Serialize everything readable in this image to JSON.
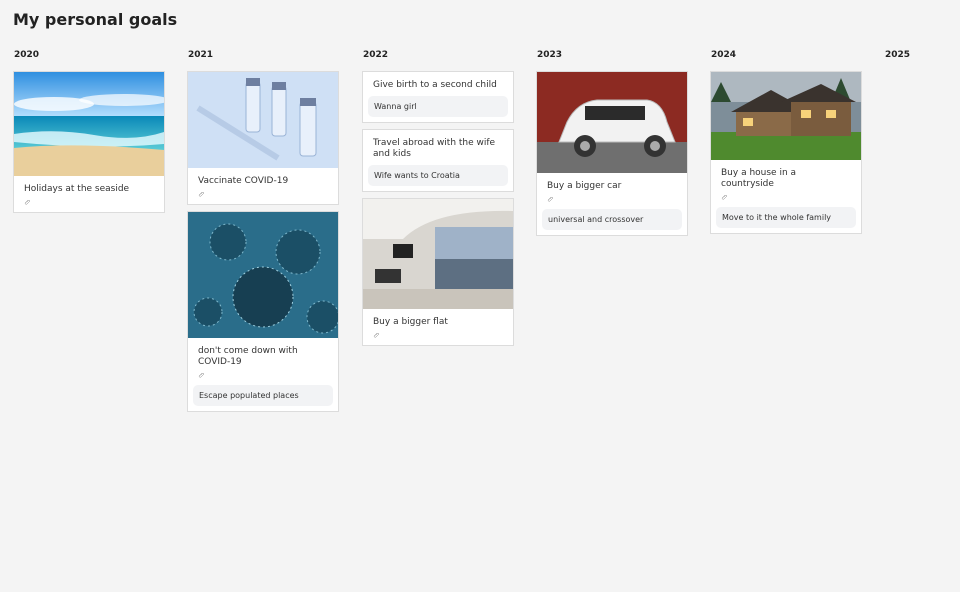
{
  "page": {
    "title": "My personal goals"
  },
  "columns": [
    {
      "year": "2020",
      "cards": [
        {
          "title": "Holidays at the seaside",
          "image": "seaside-photo",
          "attachment": true,
          "note": ""
        }
      ]
    },
    {
      "year": "2021",
      "cards": [
        {
          "title": "Vaccinate COVID-19",
          "image": "vaccine-photo",
          "attachment": true,
          "note": ""
        },
        {
          "title": "don't come down with COVID-19",
          "image": "virus-photo",
          "attachment": true,
          "note": "Escape populated places"
        }
      ]
    },
    {
      "year": "2022",
      "cards": [
        {
          "title": "Give birth to a second child",
          "note": "Wanna girl"
        },
        {
          "title": "Travel abroad with the wife and kids",
          "note": "Wife wants to Croatia"
        },
        {
          "title": "Buy a bigger flat",
          "image": "flat-photo",
          "attachment": true,
          "note": ""
        }
      ]
    },
    {
      "year": "2023",
      "cards": [
        {
          "title": "Buy a bigger car",
          "image": "car-photo",
          "attachment": true,
          "note": "universal and crossover"
        }
      ]
    },
    {
      "year": "2024",
      "cards": [
        {
          "title": "Buy a house in a countryside",
          "image": "house-photo",
          "attachment": true,
          "note": "Move to it the whole family"
        }
      ]
    },
    {
      "year": "2025",
      "cards": []
    }
  ],
  "icons": {
    "attachment": "paperclip-icon"
  },
  "colors": {
    "background": "#f4f4f4",
    "card": "#ffffff",
    "note": "#f2f3f5",
    "border": "#dcdcdc"
  }
}
